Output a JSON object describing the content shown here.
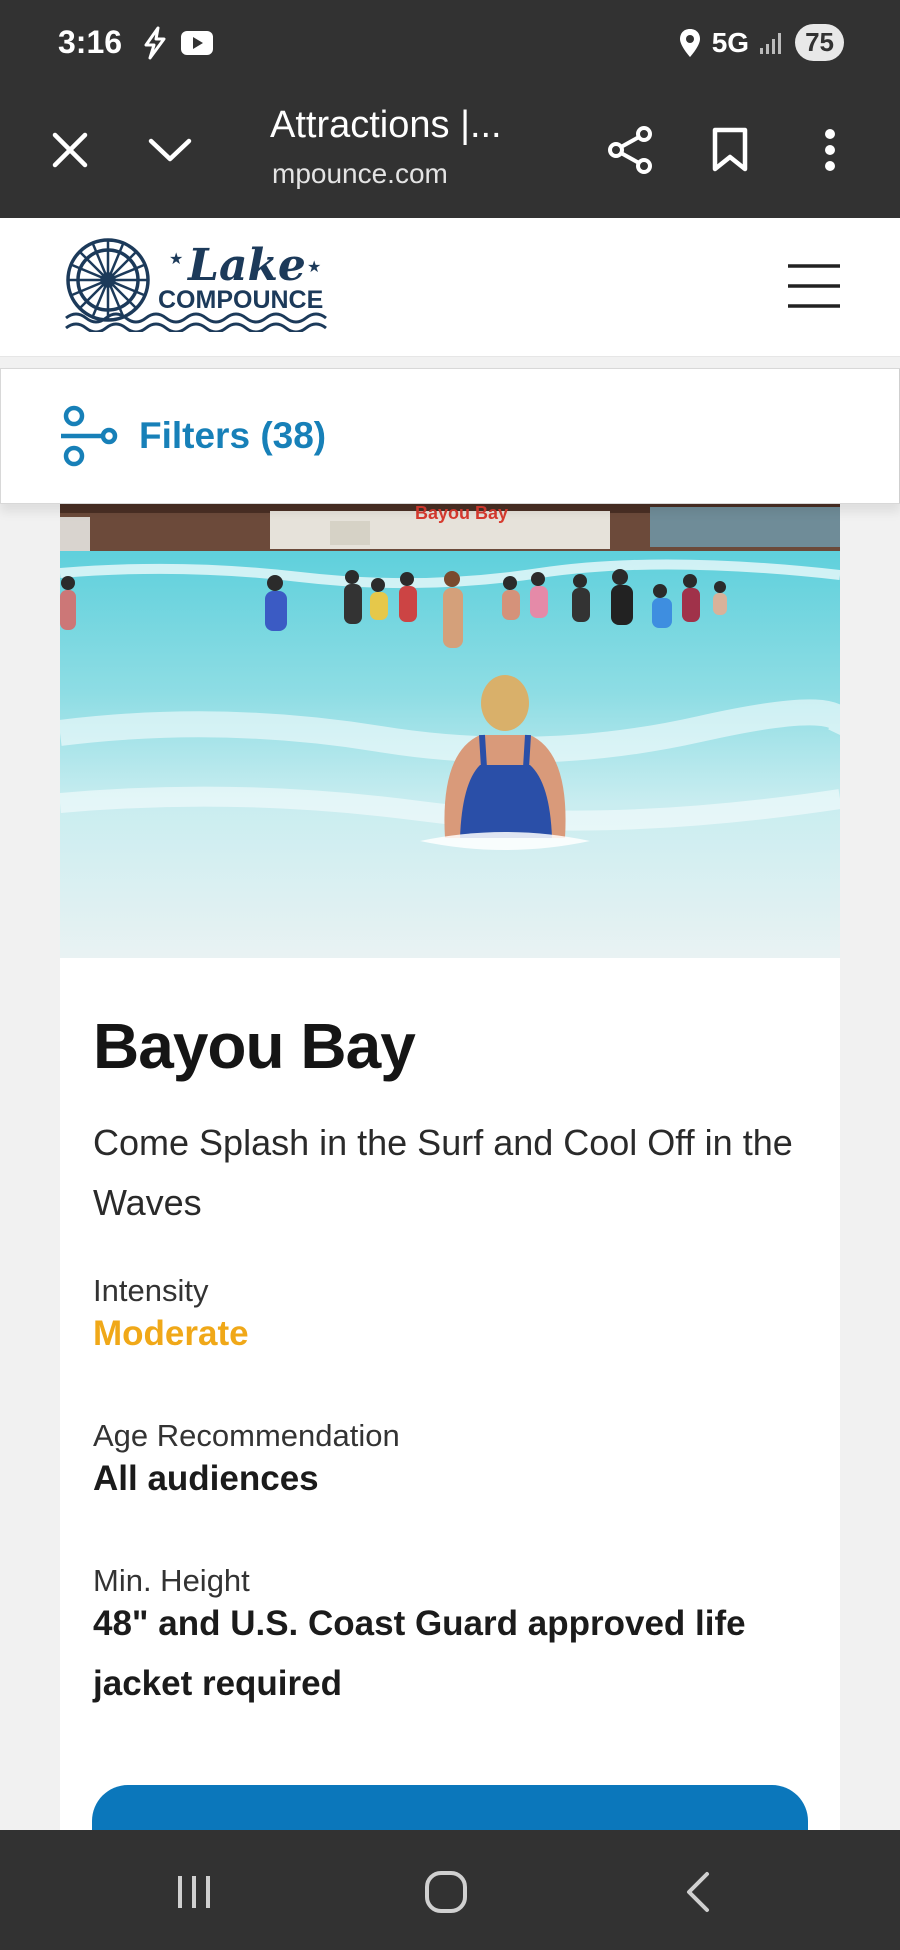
{
  "status_bar": {
    "time": "3:16",
    "network": "5G",
    "battery": "75"
  },
  "browser": {
    "page_title": "Attractions |...",
    "url": "mpounce.com"
  },
  "site": {
    "logo_script": "Lake",
    "logo_word": "COMPOUNCE"
  },
  "filters": {
    "label": "Filters (38)"
  },
  "attraction": {
    "image_sign": "Bayou Bay",
    "title": "Bayou Bay",
    "subtitle": "Come Splash in the Surf and Cool Off in the Waves",
    "intensity_label": "Intensity",
    "intensity_value": "Moderate",
    "age_label": "Age Recommendation",
    "age_value": "All audiences",
    "height_label": "Min. Height",
    "height_value": "48\" and U.S. Coast Guard approved life jacket required"
  },
  "colors": {
    "accent_blue": "#1780b8",
    "cta_blue": "#0b77bb",
    "moderate_orange": "#f0a818",
    "chrome_dark": "#323232"
  }
}
